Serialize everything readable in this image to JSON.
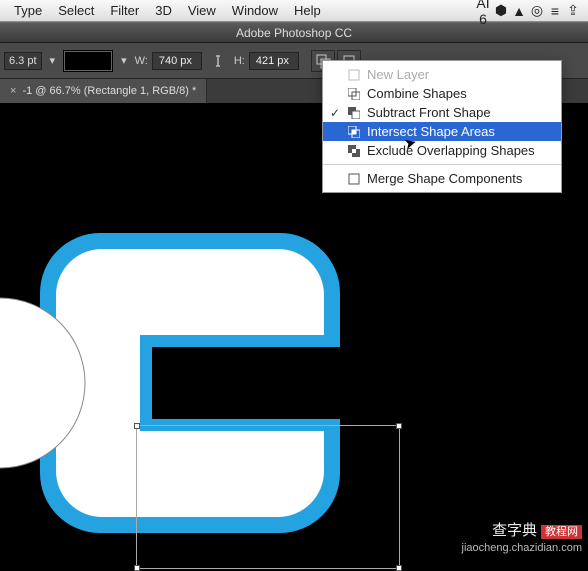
{
  "menubar": {
    "items": [
      "Type",
      "Select",
      "Filter",
      "3D",
      "View",
      "Window",
      "Help"
    ],
    "status_aicount": "AI 6"
  },
  "app": {
    "title": "Adobe Photoshop CC"
  },
  "options": {
    "stroke_pt": "6.3 pt",
    "w_label": "W:",
    "w_value": "740 px",
    "h_label": "H:",
    "h_value": "421 px"
  },
  "tab": {
    "title": "-1 @ 66.7% (Rectangle 1, RGB/8) *"
  },
  "pathops_menu": {
    "items": [
      {
        "label": "New Layer",
        "icon": "new-layer",
        "disabled": true,
        "checked": false
      },
      {
        "label": "Combine Shapes",
        "icon": "combine",
        "disabled": false,
        "checked": false
      },
      {
        "label": "Subtract Front Shape",
        "icon": "subtract",
        "disabled": false,
        "checked": true
      },
      {
        "label": "Intersect Shape Areas",
        "icon": "intersect",
        "disabled": false,
        "checked": false,
        "selected": true
      },
      {
        "label": "Exclude Overlapping Shapes",
        "icon": "exclude",
        "disabled": false,
        "checked": false
      }
    ],
    "merge_label": "Merge Shape Components"
  },
  "watermark": {
    "line1_a": "查字典",
    "line1_b": "教程网",
    "url": "jiaocheng.chazidian.com"
  },
  "colors": {
    "accent": "#25a3e0",
    "menu_highlight": "#2a67d3"
  }
}
